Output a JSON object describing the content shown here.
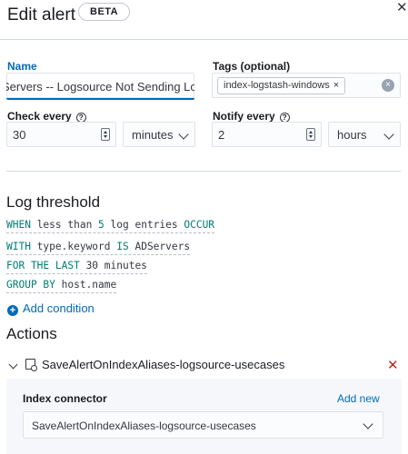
{
  "header": {
    "title": "Edit alert",
    "badge": "BETA",
    "close_icon": "close-icon"
  },
  "form": {
    "name": {
      "label": "Name",
      "value": "Servers -- Logsource Not Sending Logs"
    },
    "tags": {
      "label": "Tags (optional)",
      "tag": "index-logstash-windows",
      "remove_glyph": "×",
      "clear_glyph": "×"
    },
    "check_every": {
      "label": "Check every",
      "help_glyph": "?",
      "value": "30",
      "unit": "minutes"
    },
    "notify_every": {
      "label": "Notify every",
      "help_glyph": "?",
      "value": "2",
      "unit": "hours"
    }
  },
  "threshold": {
    "title": "Log threshold",
    "when": {
      "kw1": "WHEN",
      "text1": " less than ",
      "num": "5",
      "text2": " log entries ",
      "kw2": "OCCUR"
    },
    "with": {
      "kw1": "WITH",
      "text1": " type.keyword ",
      "kw2": "IS",
      "text2": " ADServers"
    },
    "for": {
      "kw1": "FOR THE LAST",
      "text1": " 30 minutes"
    },
    "group": {
      "kw1": "GROUP BY",
      "text1": " host.name"
    },
    "add_condition": "Add condition",
    "add_glyph": "+"
  },
  "actions": {
    "title": "Actions",
    "item_name": "SaveAlertOnIndexAliases-logsource-usecases",
    "delete_glyph": "✕",
    "connector_label": "Index connector",
    "add_new": "Add new",
    "connector_value": "SaveAlertOnIndexAliases-logsource-usecases"
  },
  "colors": {
    "accent": "#006bb8",
    "keyword": "#017d73",
    "danger": "#bd271e"
  }
}
